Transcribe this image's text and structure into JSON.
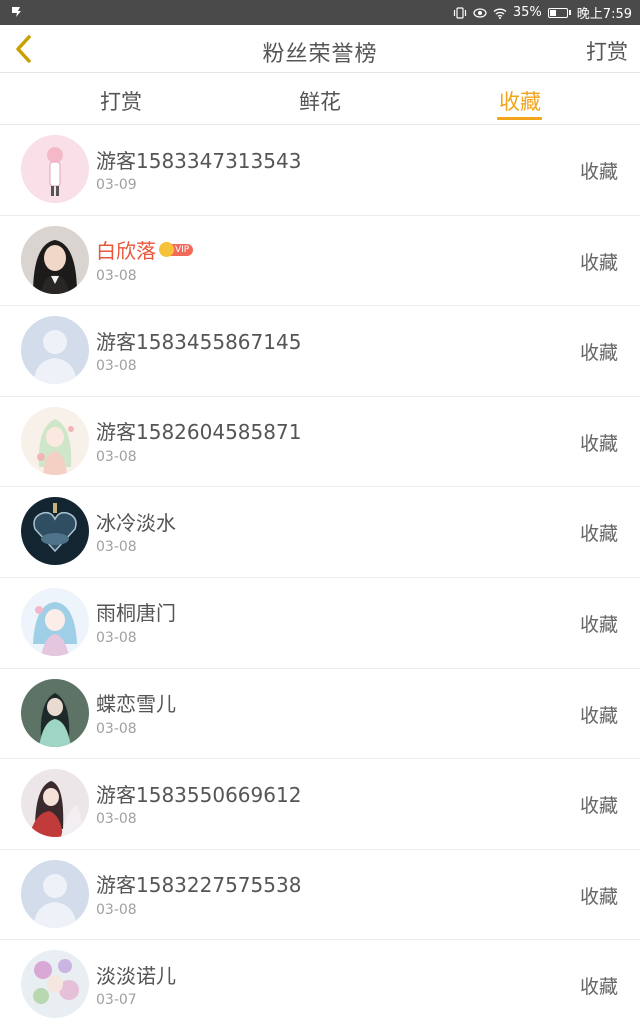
{
  "status_bar": {
    "battery": "35%",
    "time": "晚上7:59",
    "battery_level": 0.35,
    "icons": [
      "notification-icon",
      "vibrate-icon",
      "eye-icon",
      "wifi-icon",
      "battery-icon"
    ]
  },
  "header": {
    "back_icon": "chevron-left-icon",
    "title": "粉丝荣誉榜",
    "action": "打赏",
    "accent_color": "#c9a000"
  },
  "tabs": [
    {
      "label": "打赏",
      "active": false
    },
    {
      "label": "鲜花",
      "active": false
    },
    {
      "label": "收藏",
      "active": true
    }
  ],
  "accent_color": "#f2a51a",
  "fans": [
    {
      "name": "游客1583347313543",
      "date": "03-09",
      "action": "收藏",
      "avatar": "pink-anime-avatar"
    },
    {
      "name": "白欣落",
      "date": "03-08",
      "action": "收藏",
      "vip": "VIP",
      "avatar": "photo-girl-avatar"
    },
    {
      "name": "游客1583455867145",
      "date": "03-08",
      "action": "收藏",
      "avatar": "default-avatar"
    },
    {
      "name": "游客1582604585871",
      "date": "03-08",
      "action": "收藏",
      "avatar": "anime-girl-avatar"
    },
    {
      "name": "冰冷淡水",
      "date": "03-08",
      "action": "收藏",
      "avatar": "dark-heart-avatar"
    },
    {
      "name": "雨桐唐门",
      "date": "03-08",
      "action": "收藏",
      "avatar": "blue-anime-avatar"
    },
    {
      "name": "蝶恋雪儿",
      "date": "03-08",
      "action": "收藏",
      "avatar": "green-anime-avatar"
    },
    {
      "name": "游客1583550669612",
      "date": "03-08",
      "action": "收藏",
      "avatar": "red-anime-avatar"
    },
    {
      "name": "游客1583227575538",
      "date": "03-08",
      "action": "收藏",
      "avatar": "default-avatar"
    },
    {
      "name": "淡淡诺儿",
      "date": "03-07",
      "action": "收藏",
      "avatar": "flower-avatar"
    }
  ]
}
